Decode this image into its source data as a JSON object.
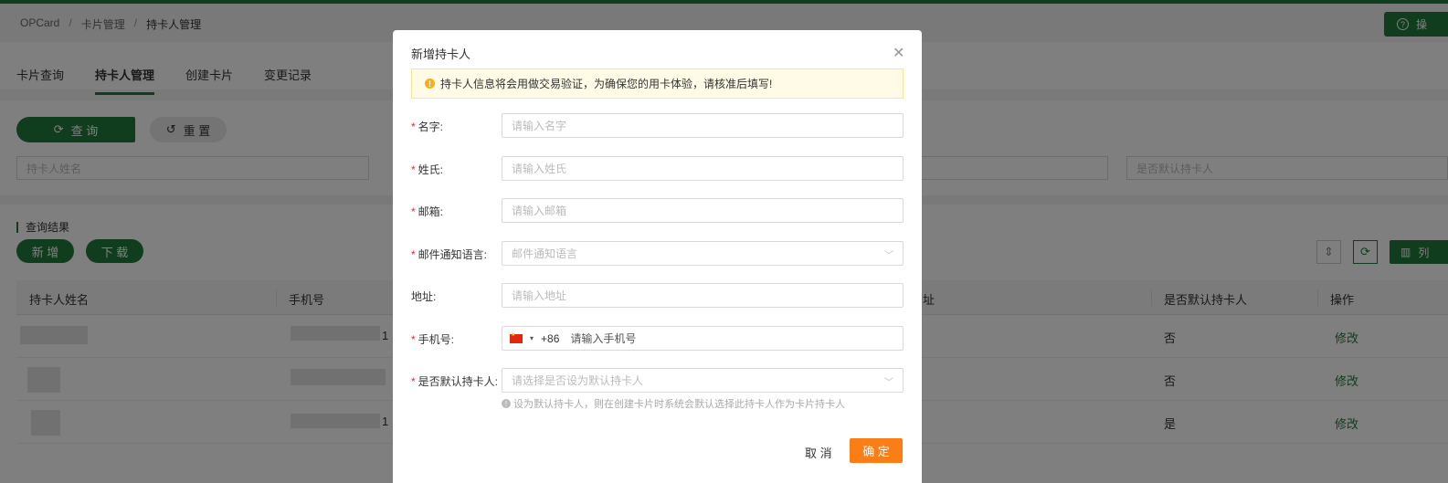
{
  "breadcrumb": [
    "OPCard",
    "卡片管理",
    "持卡人管理"
  ],
  "header": {
    "help_label": "操"
  },
  "tabs": [
    "卡片查询",
    "持卡人管理",
    "创建卡片",
    "变更记录"
  ],
  "filters": {
    "query_label": "查 询",
    "reset_label": "重 置",
    "name_placeholder": "持卡人姓名",
    "default_placeholder": "是否默认持卡人"
  },
  "results": {
    "title": "查询结果",
    "add_label": "新 增",
    "download_label": "下 载",
    "columns_label": "列",
    "headers": [
      "持卡人姓名",
      "手机号",
      "址",
      "是否默认持卡人",
      "操作"
    ],
    "rows": [
      {
        "phone_tail": "1",
        "is_default": "否",
        "action": "修改"
      },
      {
        "phone_tail": "",
        "is_default": "否",
        "action": "修改"
      },
      {
        "phone_tail": "1",
        "is_default": "是",
        "action": "修改"
      }
    ]
  },
  "modal": {
    "title": "新增持卡人",
    "alert": "持卡人信息将会用做交易验证，为确保您的用卡体验，请核准后填写!",
    "fields": {
      "first_name": {
        "label": "名字:",
        "placeholder": "请输入名字"
      },
      "last_name": {
        "label": "姓氏:",
        "placeholder": "请输入姓氏"
      },
      "email": {
        "label": "邮箱:",
        "placeholder": "请输入邮箱"
      },
      "language": {
        "label": "邮件通知语言:",
        "placeholder": "邮件通知语言"
      },
      "address": {
        "label": "地址:",
        "placeholder": "请输入地址"
      },
      "phone": {
        "label": "手机号:",
        "code": "+86",
        "placeholder": "请输入手机号"
      },
      "is_default": {
        "label": "是否默认持卡人:",
        "placeholder": "请选择是否设为默认持卡人"
      }
    },
    "hint": "设为默认持卡人，则在创建卡片时系统会默认选择此持卡人作为卡片持卡人",
    "cancel_label": "取 消",
    "confirm_label": "确 定"
  },
  "colors": {
    "brand": "#1f7a3a",
    "confirm": "#fa7d16",
    "required": "#f5222d"
  }
}
